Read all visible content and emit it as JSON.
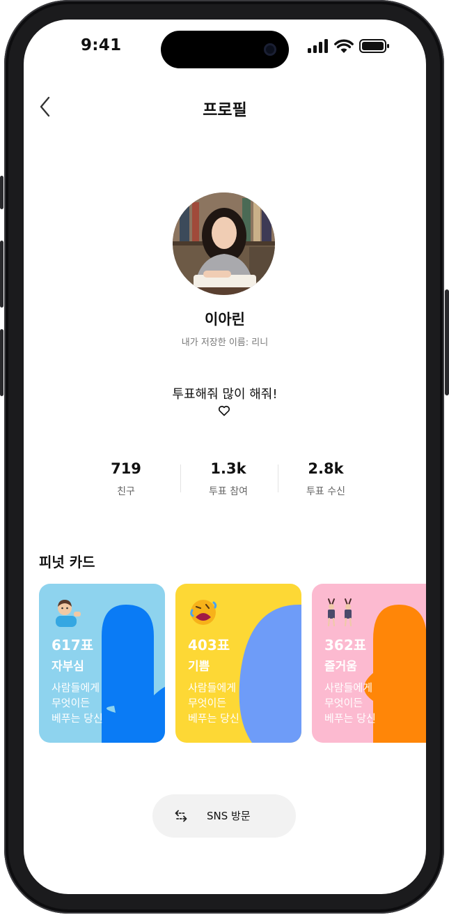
{
  "status_bar": {
    "time": "9:41"
  },
  "nav": {
    "title": "프로필"
  },
  "profile": {
    "name": "이아린",
    "saved_name": "내가 저장한 이름: 리니",
    "status_message": "투표해줘 많이 해줘!"
  },
  "stats": [
    {
      "value": "719",
      "label": "친구"
    },
    {
      "value": "1.3k",
      "label": "투표 참여"
    },
    {
      "value": "2.8k",
      "label": "투표 수신"
    }
  ],
  "cards_section": {
    "title": "피넛 카드"
  },
  "cards": [
    {
      "votes": "617표",
      "word": "자부심",
      "desc": [
        "사람들에게",
        "무엇이든",
        "베푸는 당신"
      ],
      "bg": "#8ED3EE",
      "shape": "#0A7BF5",
      "icon": "person-tipping-hand-icon"
    },
    {
      "votes": "403표",
      "word": "기쁨",
      "desc": [
        "사람들에게",
        "무엇이든",
        "베푸는 당신"
      ],
      "bg": "#FDD835",
      "shape": "#6E9CF8",
      "icon": "rolling-laughing-face-icon"
    },
    {
      "votes": "362표",
      "word": "즐거움",
      "desc": [
        "사람들에게",
        "무엇이든",
        "베푸는 당신"
      ],
      "bg": "#FCBAD0",
      "shape": "#FF8608",
      "icon": "dancing-bunnies-icon"
    }
  ],
  "sns_button": {
    "label": "SNS 방문"
  }
}
